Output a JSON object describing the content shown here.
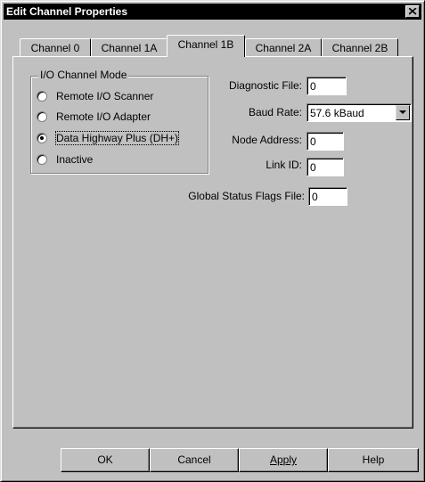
{
  "window": {
    "title": "Edit Channel Properties"
  },
  "tabs": [
    {
      "label": "Channel 0",
      "active": false
    },
    {
      "label": "Channel 1A",
      "active": false
    },
    {
      "label": "Channel 1B",
      "active": true
    },
    {
      "label": "Channel 2A",
      "active": false
    },
    {
      "label": "Channel 2B",
      "active": false
    }
  ],
  "mode_group": {
    "legend": "I/O Channel Mode",
    "options": [
      {
        "label": "Remote I/O Scanner",
        "selected": false
      },
      {
        "label": "Remote I/O Adapter",
        "selected": false
      },
      {
        "label": "Data Highway Plus (DH+)",
        "selected": true
      },
      {
        "label": "Inactive",
        "selected": false
      }
    ]
  },
  "fields": {
    "diagnostic_file": {
      "label": "Diagnostic File:",
      "value": "0"
    },
    "baud_rate": {
      "label": "Baud Rate:",
      "value": "57.6 kBaud"
    },
    "node_address": {
      "label": "Node Address:",
      "value": "0"
    },
    "link_id": {
      "label": "Link ID:",
      "value": "0"
    },
    "global_status_flags_file": {
      "label": "Global Status Flags File:",
      "value": "0"
    }
  },
  "buttons": {
    "ok": "OK",
    "cancel": "Cancel",
    "apply": "Apply",
    "help": "Help"
  },
  "icons": {
    "close": "close-icon",
    "dropdown": "chevron-down-icon"
  }
}
